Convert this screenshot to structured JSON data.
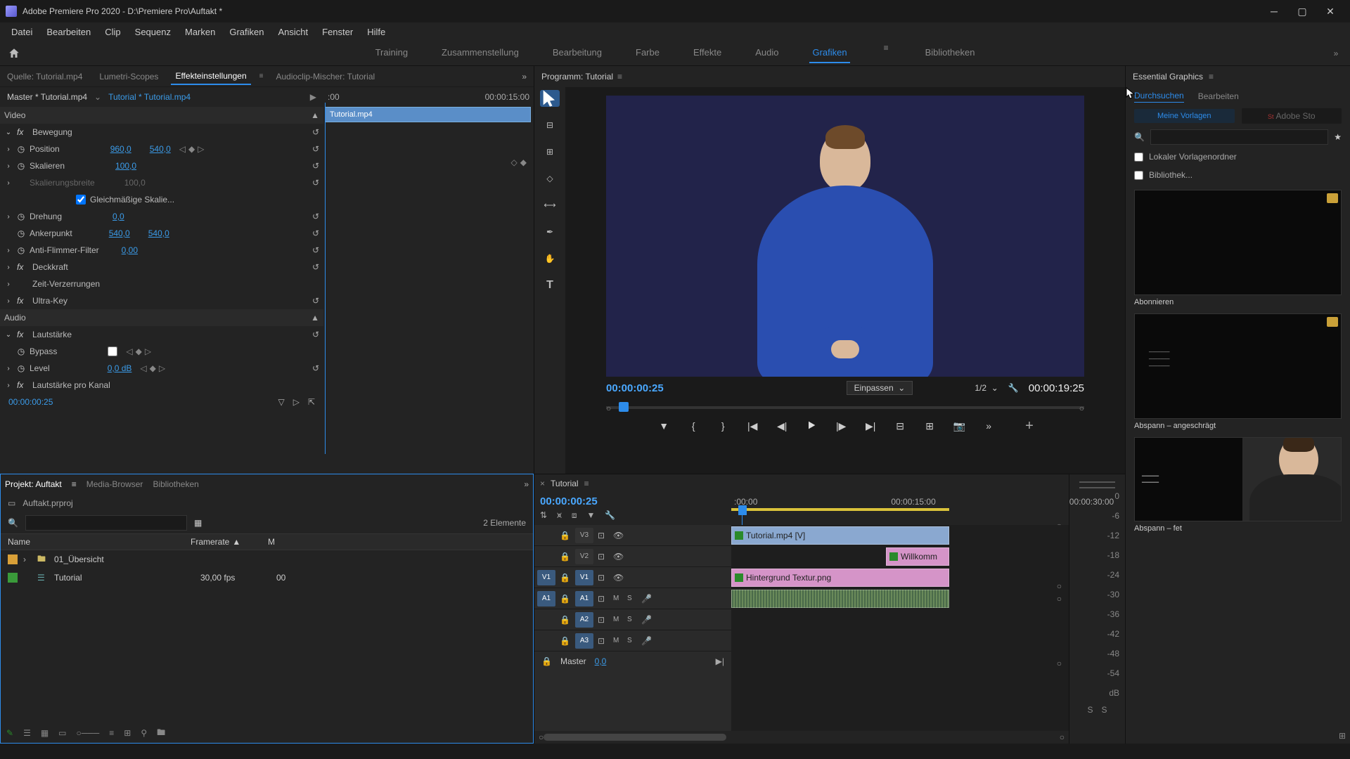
{
  "window": {
    "title": "Adobe Premiere Pro 2020 - D:\\Premiere Pro\\Auftakt *"
  },
  "menu": [
    "Datei",
    "Bearbeiten",
    "Clip",
    "Sequenz",
    "Marken",
    "Grafiken",
    "Ansicht",
    "Fenster",
    "Hilfe"
  ],
  "workspaces": {
    "items": [
      "Training",
      "Zusammenstellung",
      "Bearbeitung",
      "Farbe",
      "Effekte",
      "Audio",
      "Grafiken",
      "Bibliotheken"
    ],
    "active": "Grafiken"
  },
  "source_tabs": {
    "items": [
      "Quelle: Tutorial.mp4",
      "Lumetri-Scopes",
      "Effekteinstellungen",
      "Audioclip-Mischer: Tutorial"
    ],
    "active": "Effekteinstellungen"
  },
  "effect_controls": {
    "master": "Master * Tutorial.mp4",
    "sequence": "Tutorial * Tutorial.mp4",
    "time_left": ":00",
    "time_right": "00:00:15:00",
    "clip_label": "Tutorial.mp4",
    "video_label": "Video",
    "audio_label": "Audio",
    "bewegung": "Bewegung",
    "position": "Position",
    "pos_x": "960,0",
    "pos_y": "540,0",
    "skalieren": "Skalieren",
    "skal_v": "100,0",
    "skalbreite": "Skalierungsbreite",
    "skalb_v": "100,0",
    "gleich": "Gleichmäßige Skalie...",
    "drehung": "Drehung",
    "dreh_v": "0,0",
    "anker": "Ankerpunkt",
    "ank_x": "540,0",
    "ank_y": "540,0",
    "anti": "Anti-Flimmer-Filter",
    "anti_v": "0,00",
    "deckkraft": "Deckkraft",
    "zeit": "Zeit-Verzerrungen",
    "ultra": "Ultra-Key",
    "laut": "Lautstärke",
    "bypass": "Bypass",
    "level": "Level",
    "level_v": "0,0 dB",
    "lautkanal": "Lautstärke pro Kanal",
    "tc": "00:00:00:25"
  },
  "project": {
    "tabs": [
      "Projekt: Auftakt",
      "Media-Browser",
      "Bibliotheken"
    ],
    "file": "Auftakt.prproj",
    "count": "2 Elemente",
    "col_name": "Name",
    "col_rate": "Framerate",
    "col_m": "M",
    "bin": "01_Übersicht",
    "seq": "Tutorial",
    "seq_rate": "30,00 fps",
    "seq_m": "00"
  },
  "program": {
    "title": "Programm: Tutorial",
    "tc": "00:00:00:25",
    "fit": "Einpassen",
    "zoom": "1/2",
    "dur": "00:00:19:25"
  },
  "timeline": {
    "seq": "Tutorial",
    "tc": "00:00:00:25",
    "ticks": [
      ":00:00",
      "00:00:15:00",
      "00:00:30:00"
    ],
    "v3": "V3",
    "v2": "V2",
    "v1": "V1",
    "a1": "A1",
    "a2": "A2",
    "a3": "A3",
    "src_v1": "V1",
    "src_a1": "A1",
    "clip_v3": "Tutorial.mp4 [V]",
    "clip_v2": "Willkomm",
    "clip_v1": "Hintergrund Textur.png",
    "master": "Master",
    "master_v": "0,0"
  },
  "meters": {
    "scale": [
      "0",
      "-6",
      "-12",
      "-18",
      "-24",
      "-30",
      "-36",
      "-42",
      "-48",
      "-54",
      "dB"
    ],
    "s": "S"
  },
  "eg": {
    "title": "Essential Graphics",
    "browse": "Durchsuchen",
    "edit": "Bearbeiten",
    "my": "Meine Vorlagen",
    "stock": "Adobe Sto",
    "local": "Lokaler Vorlagenordner",
    "lib": "Bibliothek...",
    "t1": "Abonnieren",
    "t2": "Abspann – angeschrägt",
    "t3": "Abspann – fet"
  }
}
